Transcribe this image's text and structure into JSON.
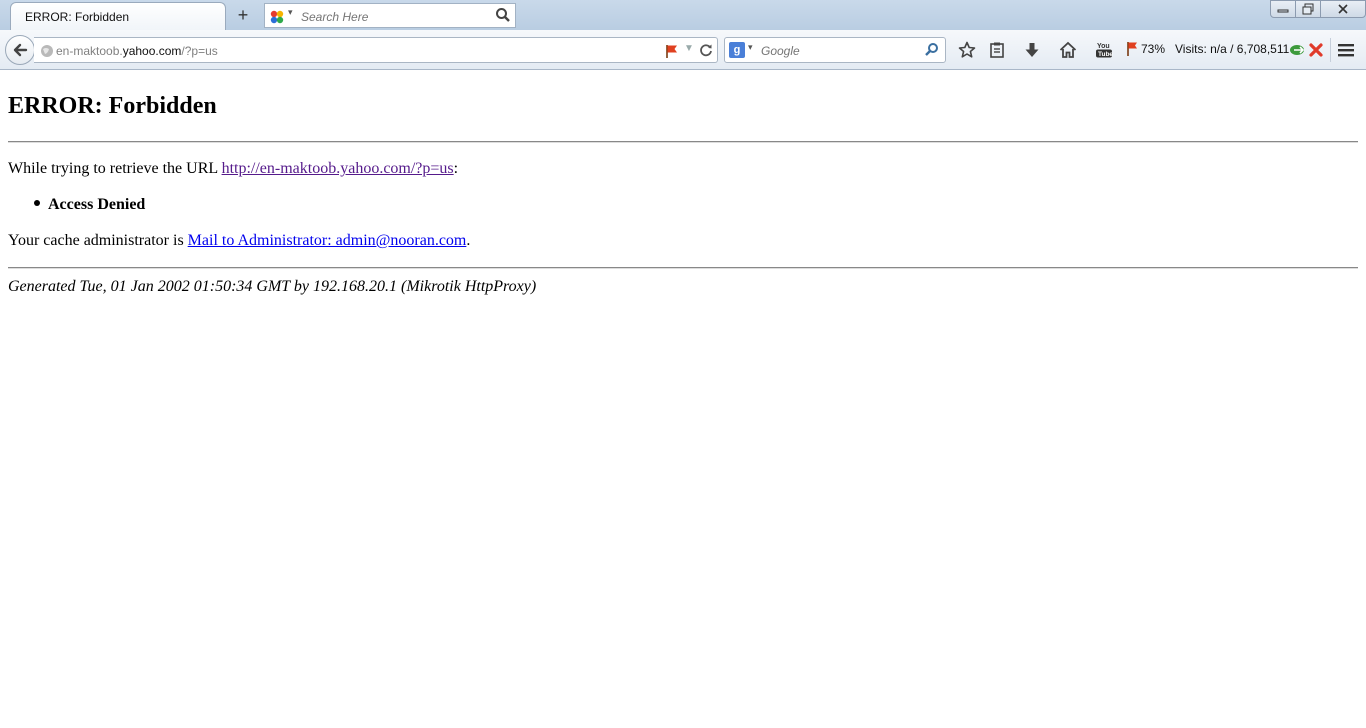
{
  "window": {
    "controls": {
      "minimize": "minimize",
      "restore": "restore",
      "close": "close"
    }
  },
  "tab": {
    "title": "ERROR: Forbidden",
    "new_tab_label": "+"
  },
  "tab_search": {
    "placeholder": "Search Here"
  },
  "navbar": {
    "url_host_prefix": "en-maktoob.",
    "url_host": "yahoo.com",
    "url_path": "/?p=us",
    "search_placeholder": "Google",
    "zoom_percent": "73%",
    "visits": "Visits: n/a / 6,708,511"
  },
  "page": {
    "heading": "ERROR: Forbidden",
    "retrieve_prefix": "While trying to retrieve the URL ",
    "retrieve_url": "http://en-maktoob.yahoo.com/?p=us",
    "retrieve_suffix": ":",
    "error_item": "Access Denied",
    "admin_prefix": "Your cache administrator is ",
    "admin_link": "Mail to Administrator: admin@nooran.com",
    "admin_suffix": ".",
    "footer": "Generated Tue, 01 Jan 2002 01:50:34 GMT by 192.168.20.1 (Mikrotik HttpProxy)"
  },
  "colors": {
    "visited_link": "#551a8b",
    "link": "#0000ee",
    "titlebar": "#c9d9ea",
    "flag_red": "#e04020"
  }
}
